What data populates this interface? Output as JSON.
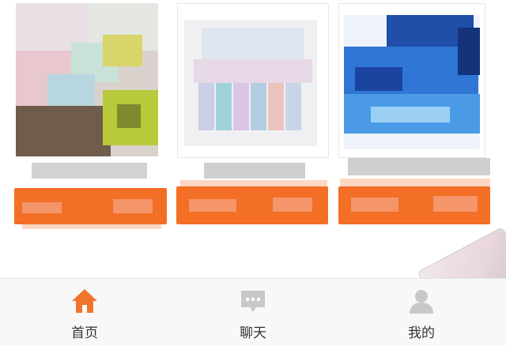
{
  "tabbar": {
    "home_label": "首页",
    "chat_label": "聊天",
    "mine_label": "我的"
  },
  "icons": {
    "home": "home-icon",
    "chat": "chat-bubble-icon",
    "mine": "user-icon"
  },
  "colors": {
    "accent": "#f26f25",
    "home_icon": "#f0752c",
    "inactive_icon": "#c8c8c8"
  }
}
